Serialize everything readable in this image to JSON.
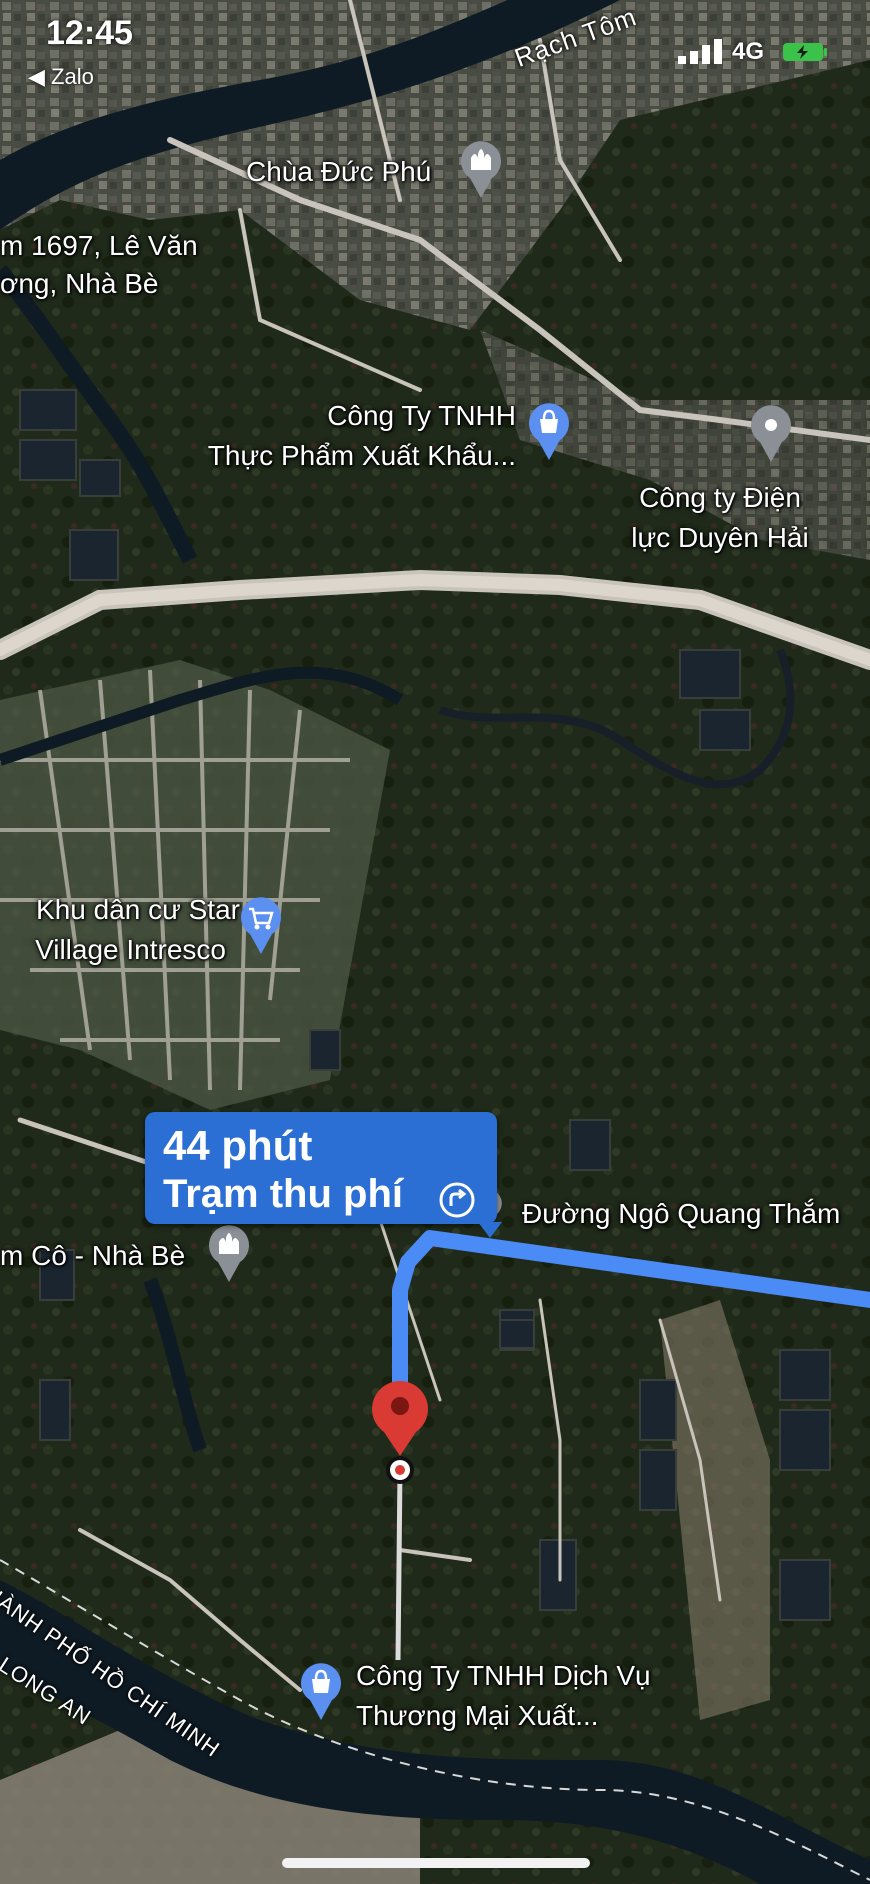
{
  "status_bar": {
    "time": "12:45",
    "back_app": "Zalo",
    "network": "4G"
  },
  "place_labels": {
    "chua_duc_phu": "Chùa Đức Phú",
    "address_line1": "m 1697, Lê Văn",
    "address_line2": "ơng, Nhà Bè",
    "cong_ty_tp_line1": "Công Ty TNHH",
    "cong_ty_tp_line2": "Thực Phẩm Xuất Khẩu...",
    "dien_luc_line1": "Công ty Điện",
    "dien_luc_line2": "lực Duyên Hải",
    "star_village_line1": "Khu dân cư Star",
    "star_village_line2": "Village Intresco",
    "duong_ngo_quang_tham": "Đường Ngô Quang Thắm",
    "m_co_nha_be": "m Cô - Nhà Bè",
    "dich_vu_line1": "Công Ty TNHH Dịch Vụ",
    "dich_vu_line2": "Thương Mại Xuất...",
    "rach_tom": "Rạch Tôm",
    "hcm_boundary": "HÀNH PHỐ HỒ CHÍ MINH",
    "long_an": "LONG AN"
  },
  "route": {
    "duration": "44 phút",
    "via": "Trạm thu phí",
    "route_color": "#4a8bf5",
    "callout_color": "#2c6fd4"
  },
  "icons": {
    "temple": "temple-icon",
    "shopping_bag": "shopping-bag-icon",
    "location_pin": "location-pin-icon",
    "shopping_cart": "shopping-cart-icon",
    "destination_marker": "destination-pin-icon",
    "route_alternative": "route-alternative-icon"
  }
}
